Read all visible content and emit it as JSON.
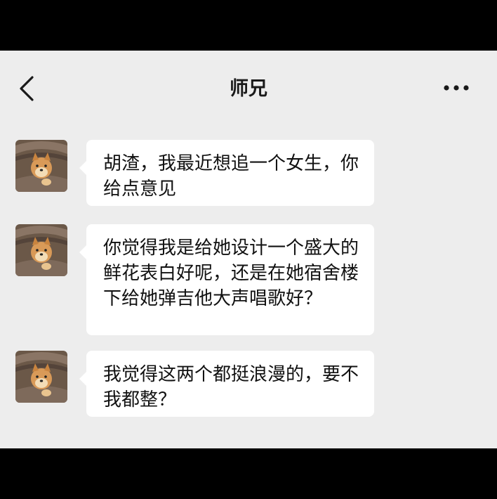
{
  "header": {
    "title": "师兄",
    "back_icon": "chevron-left-icon",
    "more_icon": "more-horizontal-icon"
  },
  "messages": [
    {
      "sender": "other",
      "avatar_icon": "shiba-dog-avatar",
      "text": "胡渣，我最近想追一个女生，你给点意见"
    },
    {
      "sender": "other",
      "avatar_icon": "shiba-dog-avatar",
      "text": "你觉得我是给她设计一个盛大的鲜花表白好呢，还是在她宿舍楼下给她弹吉他大声唱歌好？"
    },
    {
      "sender": "other",
      "avatar_icon": "shiba-dog-avatar",
      "text": "我觉得这两个都挺浪漫的，要不我都整？"
    }
  ],
  "colors": {
    "background": "#ededed",
    "bubble": "#ffffff",
    "frame": "#000000",
    "text": "#111111"
  }
}
